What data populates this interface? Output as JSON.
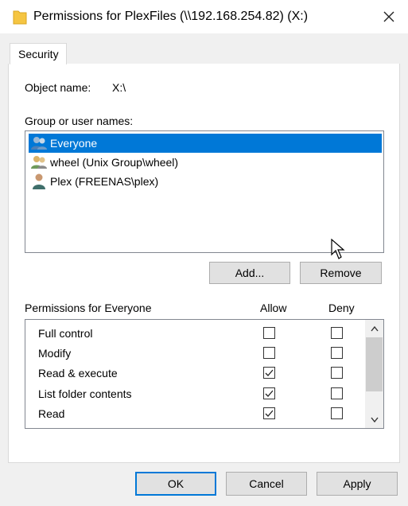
{
  "window": {
    "title": "Permissions for PlexFiles (\\\\192.168.254.82) (X:)",
    "close_icon": "close-icon"
  },
  "tabs": [
    {
      "label": "Security",
      "selected": true
    }
  ],
  "object": {
    "label": "Object name:",
    "value": "X:\\"
  },
  "groups": {
    "label": "Group or user names:",
    "items": [
      {
        "name": "Everyone",
        "icon": "group-icon",
        "selected": true
      },
      {
        "name": "wheel (Unix Group\\wheel)",
        "icon": "group-icon",
        "selected": false
      },
      {
        "name": "Plex (FREENAS\\plex)",
        "icon": "user-icon",
        "selected": false
      }
    ],
    "add_label": "Add...",
    "remove_label": "Remove"
  },
  "permissions": {
    "title": "Permissions for Everyone",
    "allow_header": "Allow",
    "deny_header": "Deny",
    "items": [
      {
        "name": "Full control",
        "allow": false,
        "deny": false
      },
      {
        "name": "Modify",
        "allow": false,
        "deny": false
      },
      {
        "name": "Read & execute",
        "allow": true,
        "deny": false
      },
      {
        "name": "List folder contents",
        "allow": true,
        "deny": false
      },
      {
        "name": "Read",
        "allow": true,
        "deny": false
      }
    ]
  },
  "footer": {
    "ok_label": "OK",
    "cancel_label": "Cancel",
    "apply_label": "Apply"
  },
  "colors": {
    "selection": "#0078d7",
    "button_face": "#e1e1e1",
    "accent_border": "#0078d7"
  }
}
